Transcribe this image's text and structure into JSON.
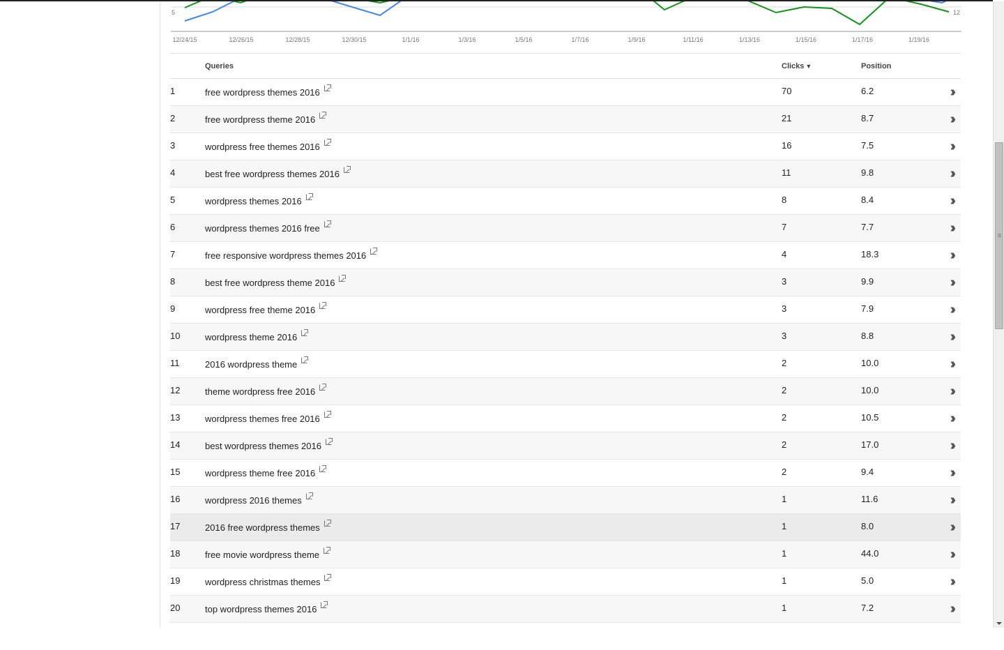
{
  "chart": {
    "y_left_label": "5",
    "y_right_label": "12",
    "x_labels": [
      "12/24/15",
      "12/26/15",
      "12/28/15",
      "12/30/15",
      "1/1/16",
      "1/3/16",
      "1/5/16",
      "1/7/16",
      "1/9/16",
      "1/11/16",
      "1/13/16",
      "1/15/16",
      "1/17/16",
      "1/19/16"
    ],
    "colors": {
      "clicks": "#4285f4",
      "position": "#109618",
      "axis": "#999999"
    }
  },
  "table": {
    "headers": {
      "index": "",
      "query": "Queries",
      "clicks": "Clicks",
      "position": "Position"
    },
    "sort_indicator": "▼",
    "rows": [
      {
        "i": "1",
        "q": "free wordpress themes 2016",
        "c": "70",
        "p": "6.2"
      },
      {
        "i": "2",
        "q": "free wordpress theme 2016",
        "c": "21",
        "p": "8.7"
      },
      {
        "i": "3",
        "q": "wordpress free themes 2016",
        "c": "16",
        "p": "7.5"
      },
      {
        "i": "4",
        "q": "best free wordpress themes 2016",
        "c": "11",
        "p": "9.8"
      },
      {
        "i": "5",
        "q": "wordpress themes 2016",
        "c": "8",
        "p": "8.4"
      },
      {
        "i": "6",
        "q": "wordpress themes 2016 free",
        "c": "7",
        "p": "7.7"
      },
      {
        "i": "7",
        "q": "free responsive wordpress themes 2016",
        "c": "4",
        "p": "18.3"
      },
      {
        "i": "8",
        "q": "best free wordpress theme 2016",
        "c": "3",
        "p": "9.9"
      },
      {
        "i": "9",
        "q": "wordpress free theme 2016",
        "c": "3",
        "p": "7.9"
      },
      {
        "i": "10",
        "q": "wordpress theme 2016",
        "c": "3",
        "p": "8.8"
      },
      {
        "i": "11",
        "q": "2016 wordpress theme",
        "c": "2",
        "p": "10.0"
      },
      {
        "i": "12",
        "q": "theme wordpress free 2016",
        "c": "2",
        "p": "10.0"
      },
      {
        "i": "13",
        "q": "wordpress themes free 2016",
        "c": "2",
        "p": "10.5"
      },
      {
        "i": "14",
        "q": "best wordpress themes 2016",
        "c": "2",
        "p": "17.0"
      },
      {
        "i": "15",
        "q": "wordpress theme free 2016",
        "c": "2",
        "p": "9.4"
      },
      {
        "i": "16",
        "q": "wordpress 2016 themes",
        "c": "1",
        "p": "11.6"
      },
      {
        "i": "17",
        "q": "2016 free wordpress themes",
        "c": "1",
        "p": "8.0"
      },
      {
        "i": "18",
        "q": "free movie wordpress theme",
        "c": "1",
        "p": "44.0"
      },
      {
        "i": "19",
        "q": "wordpress christmas themes",
        "c": "1",
        "p": "5.0"
      },
      {
        "i": "20",
        "q": "top wordpress themes 2016",
        "c": "1",
        "p": "7.2"
      }
    ],
    "highlighted_row": 17,
    "row_action_icon": "double-chevron-right-icon",
    "query_link_icon": "external-link-icon"
  }
}
